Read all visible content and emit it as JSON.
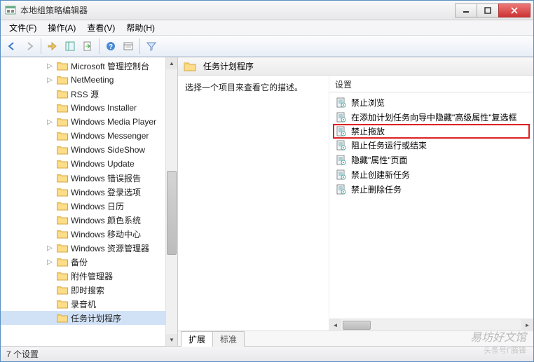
{
  "window": {
    "title": "本地组策略编辑器"
  },
  "menu": {
    "file": "文件(F)",
    "action": "操作(A)",
    "view": "查看(V)",
    "help": "帮助(H)"
  },
  "tree": {
    "items": [
      {
        "label": "Microsoft 管理控制台",
        "expandable": true
      },
      {
        "label": "NetMeeting",
        "expandable": true
      },
      {
        "label": "RSS 源",
        "expandable": false
      },
      {
        "label": "Windows Installer",
        "expandable": false
      },
      {
        "label": "Windows Media Player",
        "expandable": true
      },
      {
        "label": "Windows Messenger",
        "expandable": false
      },
      {
        "label": "Windows SideShow",
        "expandable": false
      },
      {
        "label": "Windows Update",
        "expandable": false
      },
      {
        "label": "Windows 错误报告",
        "expandable": false
      },
      {
        "label": "Windows 登录选项",
        "expandable": false
      },
      {
        "label": "Windows 日历",
        "expandable": false
      },
      {
        "label": "Windows 颜色系统",
        "expandable": false
      },
      {
        "label": "Windows 移动中心",
        "expandable": false
      },
      {
        "label": "Windows 资源管理器",
        "expandable": true
      },
      {
        "label": "备份",
        "expandable": true
      },
      {
        "label": "附件管理器",
        "expandable": false
      },
      {
        "label": "即时搜索",
        "expandable": false
      },
      {
        "label": "录音机",
        "expandable": false
      },
      {
        "label": "任务计划程序",
        "expandable": false,
        "selected": true
      }
    ]
  },
  "details": {
    "header": "任务计划程序",
    "desc": "选择一个项目来查看它的描述。",
    "settings_hdr": "设置",
    "settings": [
      {
        "label": "禁止浏览"
      },
      {
        "label": "在添加计划任务向导中隐藏\"高级属性\"复选框"
      },
      {
        "label": "禁止拖放",
        "highlight": true
      },
      {
        "label": "阻止任务运行或结束"
      },
      {
        "label": "隐藏\"属性\"页面"
      },
      {
        "label": "禁止创建新任务"
      },
      {
        "label": "禁止删除任务"
      }
    ]
  },
  "tabs": {
    "ext": "扩展",
    "std": "标准"
  },
  "status": "7 个设置",
  "watermark1": "易坊好文馆",
  "watermark2": "头条号Г腾锋"
}
